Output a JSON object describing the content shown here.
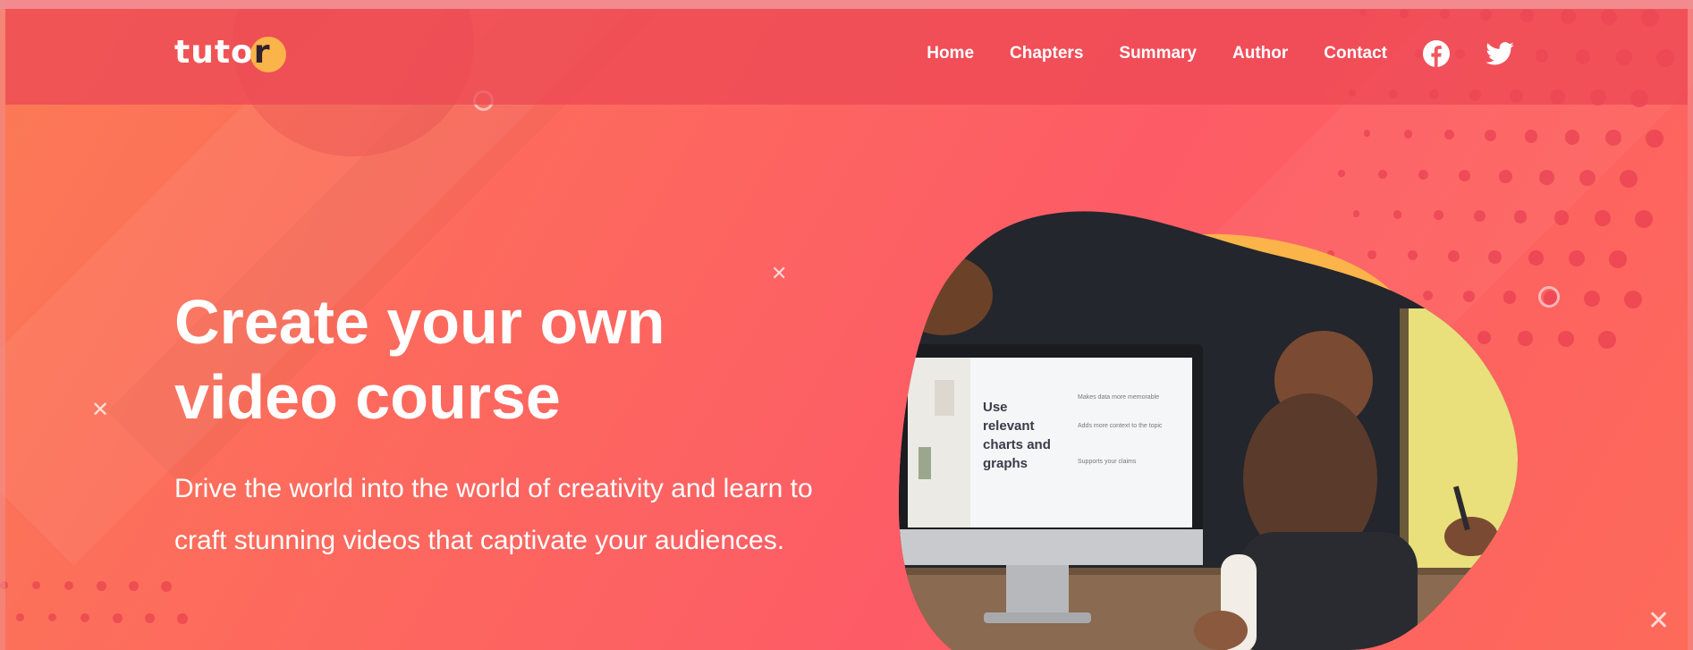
{
  "brand": {
    "logo_main": "tuto",
    "logo_accent": "r",
    "accent_color": "#fbb44a",
    "background_color": "#fd6363"
  },
  "nav": {
    "items": [
      {
        "label": "Home"
      },
      {
        "label": "Chapters"
      },
      {
        "label": "Summary"
      },
      {
        "label": "Author"
      },
      {
        "label": "Contact"
      }
    ],
    "social": [
      {
        "icon": "facebook-icon"
      },
      {
        "icon": "twitter-icon"
      }
    ]
  },
  "hero": {
    "title": "Create your own video course",
    "subtitle": "Drive the world into the world of creativity and learn to craft stunning videos that captivate your audiences."
  },
  "illustration": {
    "slide_heading": "Use relevant charts and graphs",
    "slide_bullets": [
      "Makes data more memorable",
      "Adds more context to the topic",
      "Supports your claims"
    ]
  }
}
